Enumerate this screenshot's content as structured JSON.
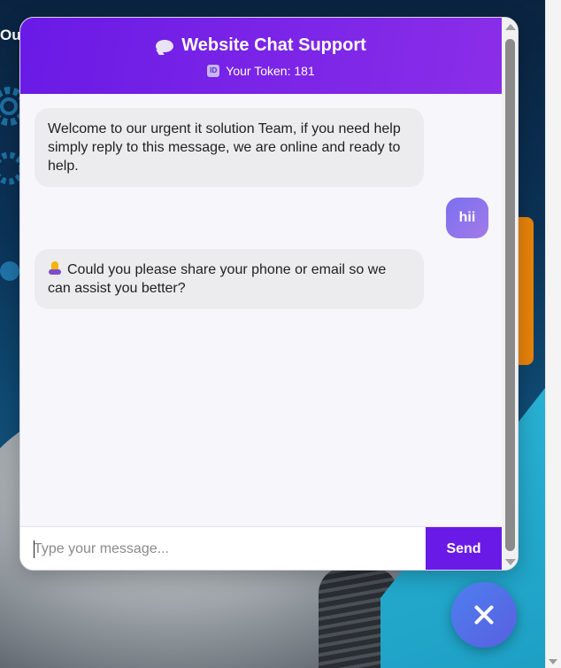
{
  "background": {
    "partial_heading": "Our"
  },
  "chat": {
    "title": "Website Chat Support",
    "title_icon": "speech-bubble-icon",
    "token_icon": "id-badge-icon",
    "token_text": "Your Token: 181",
    "messages": [
      {
        "sender": "bot",
        "text": "Welcome to our urgent it solution Team, if you need help simply reply to this message, we are online and ready to help."
      },
      {
        "sender": "user",
        "text": "hii"
      },
      {
        "sender": "bot",
        "icon": "folded-hands-icon",
        "text": "Could you please share your phone or email so we can assist you better?"
      }
    ],
    "input": {
      "placeholder": "Type your message...",
      "value": ""
    },
    "send_label": "Send"
  },
  "fab": {
    "icon": "close-icon"
  },
  "colors": {
    "header_start": "#6a1ae6",
    "header_end": "#8a2ee8",
    "user_bubble": "#8b74ec",
    "bot_bubble": "#ececef",
    "send_button": "#6a1ae6",
    "fab": "#4d7ff0"
  }
}
